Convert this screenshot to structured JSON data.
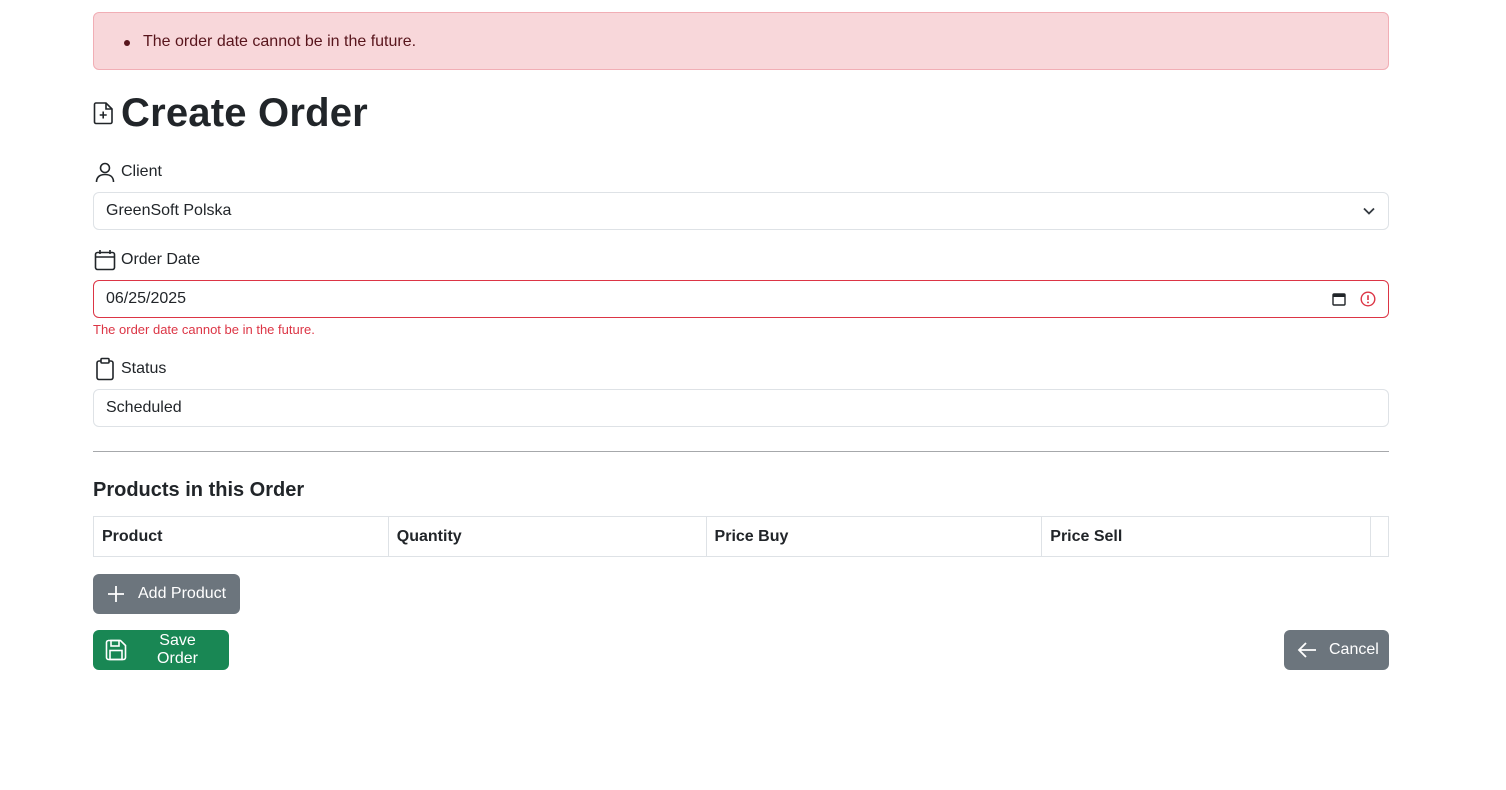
{
  "alert": {
    "errors": [
      "The order date cannot be in the future."
    ]
  },
  "header": {
    "title": "Create Order",
    "icon": "file-plus-icon"
  },
  "form": {
    "client": {
      "label": "Client",
      "icon": "person-icon",
      "value": "GreenSoft Polska"
    },
    "order_date": {
      "label": "Order Date",
      "icon": "calendar-icon",
      "value": "06/25/2025",
      "error": "The order date cannot be in the future."
    },
    "status": {
      "label": "Status",
      "icon": "clipboard-icon",
      "value": "Scheduled"
    }
  },
  "products": {
    "title": "Products in this Order",
    "columns": [
      "Product",
      "Quantity",
      "Price Buy",
      "Price Sell",
      ""
    ]
  },
  "actions": {
    "add_product": "Add Product",
    "save_order": "Save Order",
    "cancel": "Cancel"
  },
  "colors": {
    "danger": "#dc3545",
    "alert_bg": "#f8d7da",
    "secondary": "#6c757d",
    "success": "#198754"
  }
}
